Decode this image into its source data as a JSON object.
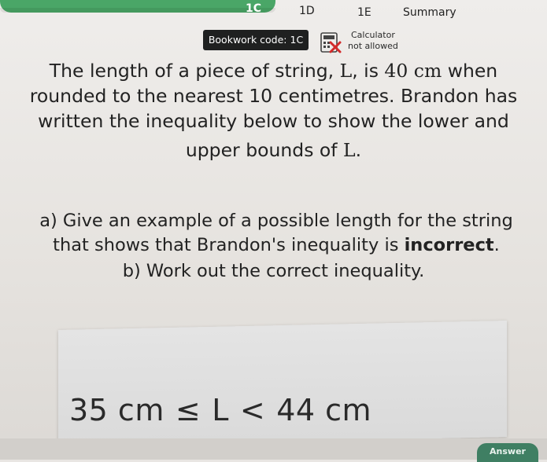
{
  "tabs": {
    "tab_1c": "1C",
    "tab_1d": "1D",
    "tab_1e": "1E",
    "tab_summary": "Summary"
  },
  "bookwork": {
    "label": "Bookwork code: 1C"
  },
  "calculator": {
    "line1": "Calculator",
    "line2": "not allowed",
    "icon": "calculator-not-allowed-icon"
  },
  "question": {
    "line1_pre": "The length of a piece of string, ",
    "line1_var": "L",
    "line1_mid": ", is ",
    "line1_val": "40 cm",
    "line1_post": " when",
    "line2": "rounded to the nearest 10 centimetres. Brandon has",
    "line3": "written the inequality below to show the lower and",
    "line4_pre": "upper bounds of ",
    "line4_var": "L",
    "line4_post": "."
  },
  "part_a": {
    "line1": "a) Give an example of a possible length for the string",
    "line2_pre": "that shows that Brandon's inequality is ",
    "line2_bold": "incorrect",
    "line2_post": "."
  },
  "part_b": {
    "line1": "b) Work out the correct inequality."
  },
  "inequality": {
    "left": "35 cm",
    "op1": "≤",
    "var": "L",
    "op2": "<",
    "right": "44 cm"
  },
  "answer_button": {
    "label": "Answer"
  },
  "colors": {
    "accent_green": "#4aa667",
    "answer_green": "#3f7f63",
    "bookwork_bg": "#1f2020"
  }
}
